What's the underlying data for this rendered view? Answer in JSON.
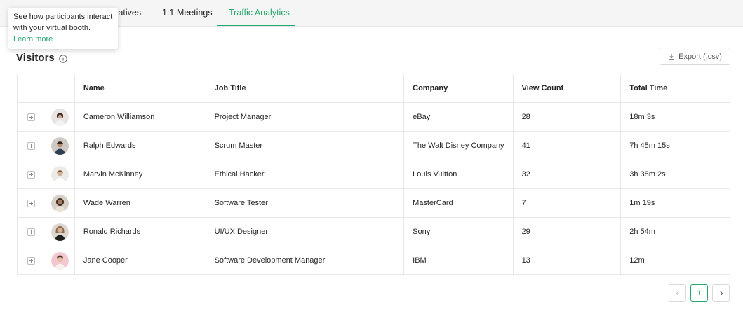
{
  "tabs": {
    "partial_label": "tatives",
    "meetings_label": "1:1 Meetings",
    "traffic_label": "Traffic Analytics",
    "active": "Traffic Analytics"
  },
  "tooltip": {
    "line1": "See how participants interact",
    "line2": "with your virtual booth.",
    "link": "Learn more"
  },
  "page": {
    "title": "Visitors",
    "export_label": "Export (.csv)"
  },
  "table": {
    "headers": [
      "Name",
      "Job Title",
      "Company",
      "View Count",
      "Total Time"
    ],
    "rows": [
      {
        "name": "Cameron Williamson",
        "job": "Project Manager",
        "company": "eBay",
        "views": "28",
        "time": "18m 3s"
      },
      {
        "name": "Ralph Edwards",
        "job": "Scrum Master",
        "company": "The Walt Disney Company",
        "views": "41",
        "time": "7h 45m 15s"
      },
      {
        "name": "Marvin McKinney",
        "job": "Ethical Hacker",
        "company": "Louis Vuitton",
        "views": "32",
        "time": "3h 38m 2s"
      },
      {
        "name": "Wade Warren",
        "job": "Software Tester",
        "company": "MasterCard",
        "views": "7",
        "time": "1m 19s"
      },
      {
        "name": "Ronald Richards",
        "job": "UI/UX Designer",
        "company": "Sony",
        "views": "29",
        "time": "2h 54m"
      },
      {
        "name": "Jane Cooper",
        "job": "Software Development Manager",
        "company": "IBM",
        "views": "13",
        "time": "12m"
      }
    ]
  },
  "pagination": {
    "current_page": "1"
  },
  "icons": {
    "info": "info-icon",
    "export": "download-icon",
    "expand": "plus-square-icon",
    "prev": "chevron-left-icon",
    "next": "chevron-right-icon"
  },
  "colors": {
    "accent": "#24a86b",
    "tab_bar_bg": "#f5f5f5",
    "border": "#e8e8e8"
  }
}
